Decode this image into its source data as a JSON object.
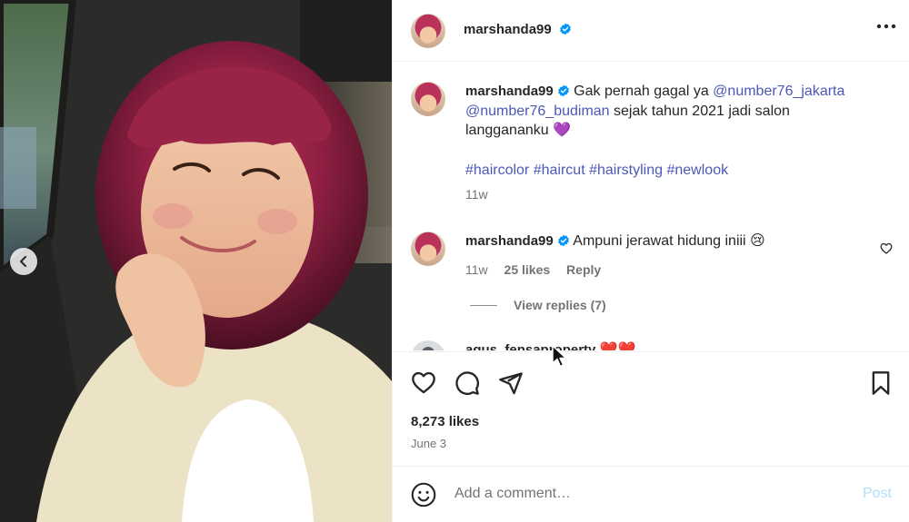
{
  "post": {
    "author": "marshanda99",
    "verified": true,
    "caption_parts": [
      {
        "type": "text",
        "value": "Gak pernah gagal ya "
      },
      {
        "type": "mention",
        "value": "@number76_jakarta"
      },
      {
        "type": "text",
        "value": " "
      },
      {
        "type": "mention",
        "value": "@number76_budiman"
      },
      {
        "type": "text",
        "value": " sejak tahun 2021 jadi salon langgananku 💜"
      }
    ],
    "hashtags": [
      "#haircolor",
      "#haircut",
      "#hairstyling",
      "#newlook"
    ],
    "caption_age": "11w",
    "likes_label": "8,273 likes",
    "date": "June 3"
  },
  "comments": [
    {
      "username": "marshanda99",
      "text": "Ampuni jerawat hidung iniii 😢",
      "age": "11w",
      "likes": "25 likes",
      "reply_label": "Reply",
      "view_replies": "View replies (7)"
    },
    {
      "username": "agus_fensaproperty",
      "text": "❤️❤️"
    }
  ],
  "comment_input": {
    "placeholder": "Add a comment…",
    "post_label": "Post"
  },
  "carousel": {
    "slides": 2,
    "active_index": 1
  },
  "icons": {
    "more": "more-horizontal-icon",
    "like": "heart-icon",
    "comment": "comment-bubble-icon",
    "share": "paper-plane-icon",
    "save": "bookmark-icon",
    "emoji": "smiley-icon",
    "prev": "chevron-left-icon"
  },
  "colors": {
    "link": "#4a58b8",
    "verified": "#0095f6",
    "muted": "#737373",
    "post_disabled": "#b2dffc"
  }
}
